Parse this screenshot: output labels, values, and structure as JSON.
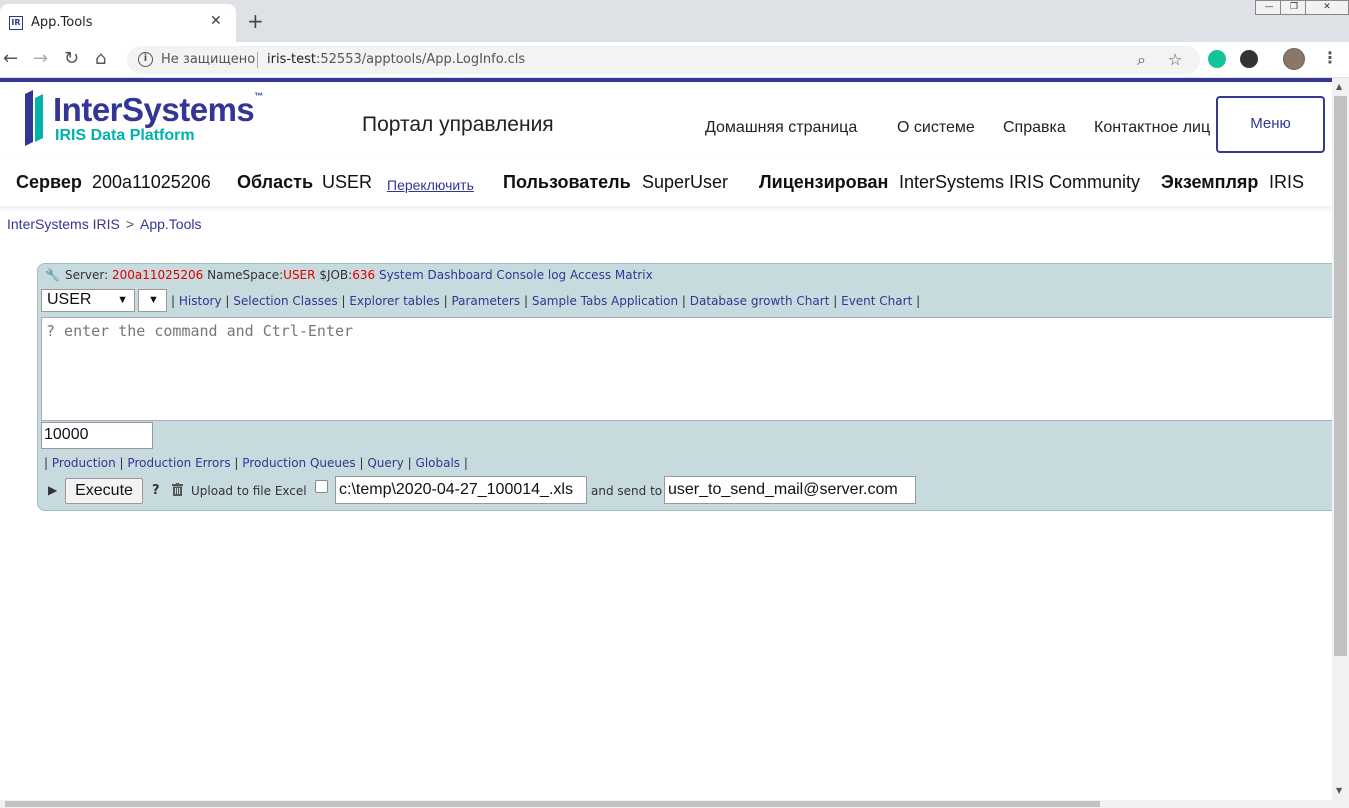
{
  "browser": {
    "tab_title": "App.Tools",
    "favicon_text": "IR",
    "tab_close": "✕",
    "new_tab": "+",
    "not_secure": "Не защищено",
    "url_host": "iris-test",
    "url_rest": ":52553/apptools/App.LogInfo.cls",
    "win_min": "—",
    "win_max": "❐",
    "win_close": "✕"
  },
  "header": {
    "logo_name": "InterSystems",
    "logo_tm": "™",
    "logo_sub": "IRIS Data Platform",
    "portal_title": "Портал управления",
    "nav": [
      "Домашняя страница",
      "О системе",
      "Справка",
      "Контактное лиц"
    ],
    "menu_button": "Меню"
  },
  "infobar": {
    "server_label": "Сервер",
    "server_value": "200a11025206",
    "namespace_label": "Область",
    "namespace_value": "USER",
    "switch_link": "Переключить",
    "user_label": "Пользователь",
    "user_value": "SuperUser",
    "license_label": "Лицензирован",
    "license_value": "InterSystems IRIS Community",
    "instance_label": "Экземпляр",
    "instance_value": "IRIS"
  },
  "breadcrumb": {
    "root": "InterSystems IRIS",
    "sep": ">",
    "current": "App.Tools"
  },
  "panel": {
    "server_label": "Server:",
    "server_value": "200a11025206",
    "namespace_label": "NameSpace:",
    "namespace_value": "USER",
    "job_label": "$JOB:",
    "job_value": "636",
    "top_links": "System Dashboard Console log Access Matrix",
    "namespace_select": "USER",
    "links1": [
      "History",
      "Selection Classes",
      "Explorer tables",
      "Parameters",
      "Sample Tabs Application",
      "Database growth Chart",
      "Event Chart"
    ],
    "command_placeholder": "? enter the command and Ctrl-Enter",
    "max_rows": "10000",
    "links2": [
      "Production",
      "Production Errors",
      "Production Queues",
      "Query",
      "Globals"
    ],
    "execute_button": "Execute",
    "help_mark": "?",
    "upload_label": "Upload to file Excel",
    "file_value": "c:\\temp\\2020-04-27_100014_.xls",
    "send_label": "and send to",
    "email_value": "user_to_send_mail@server.com"
  },
  "icons": [
    "info-icon",
    "zoom-icon",
    "star-icon",
    "grammarly-icon",
    "extension-icon",
    "profile-avatar",
    "kebab-menu-icon",
    "wrench-icon",
    "trash-icon",
    "play-icon"
  ]
}
